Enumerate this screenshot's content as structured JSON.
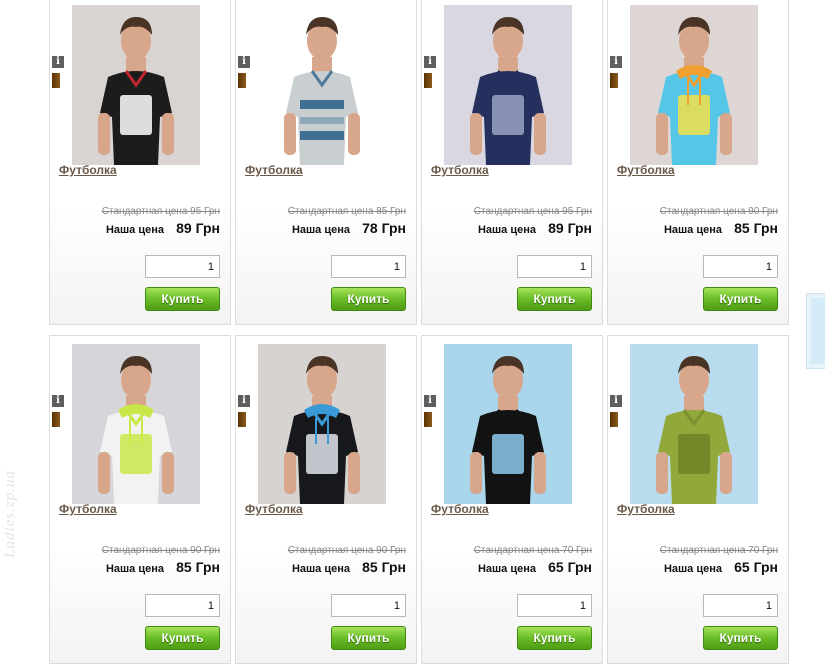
{
  "watermark": "Ladies.zp.ua",
  "buy_label": "Купить",
  "products": [
    {
      "name": "Футболка",
      "standard_price": "Стандартная цена 95 Грн",
      "our_label": "Наша цена",
      "our_price": "89 Грн",
      "qty": "1",
      "bg": "#d9d4d2",
      "shirt": "#1c1c1c",
      "trim": "#c0272d",
      "print": "#ffffff",
      "sleeve": "short",
      "hood": false
    },
    {
      "name": "Футболка",
      "standard_price": "Стандартная цена 85 Грн",
      "our_label": "Наша цена",
      "our_price": "78 Грн",
      "qty": "1",
      "bg": "#ffffff",
      "shirt": "#c9ced0",
      "trim": "#4d7a9a",
      "print": "stripes",
      "sleeve": "short",
      "hood": false
    },
    {
      "name": "Футболка",
      "standard_price": "Стандартная цена 95 Грн",
      "our_label": "Наша цена",
      "our_price": "89 Грн",
      "qty": "1",
      "bg": "#d9d7e1",
      "shirt": "#26305e",
      "trim": "#26305e",
      "print": "#9aa4c2",
      "sleeve": "short",
      "hood": false
    },
    {
      "name": "Футболка",
      "standard_price": "Стандартная цена 90 Грн",
      "our_label": "Наша цена",
      "our_price": "85 Грн",
      "qty": "1",
      "bg": "#ddd6d4",
      "shirt": "#56c6e8",
      "trim": "#f0a030",
      "print": "#f2e04a",
      "sleeve": "short",
      "hood": true
    },
    {
      "name": "Футболка",
      "standard_price": "Стандартная цена 90 Грн",
      "our_label": "Наша цена",
      "our_price": "85 Грн",
      "qty": "1",
      "bg": "#d6d6da",
      "shirt": "#f2f2f2",
      "trim": "#c8e84a",
      "print": "#c8e84a",
      "sleeve": "short",
      "hood": true
    },
    {
      "name": "Футболка",
      "standard_price": "Стандартная цена 90 Грн",
      "our_label": "Наша цена",
      "our_price": "85 Грн",
      "qty": "1",
      "bg": "#d7d3d0",
      "shirt": "#16181c",
      "trim": "#3a9ad8",
      "print": "#dfe4ea",
      "sleeve": "short",
      "hood": true
    },
    {
      "name": "Футболка",
      "standard_price": "Стандартная цена 70 Грн",
      "our_label": "Наша цена",
      "our_price": "65 Грн",
      "qty": "1",
      "bg": "#a9d6ea",
      "shirt": "#121212",
      "trim": "#121212",
      "print": "#8ec9ee",
      "sleeve": "short",
      "hood": false
    },
    {
      "name": "Футболка",
      "standard_price": "Стандартная цена 70 Грн",
      "our_label": "Наша цена",
      "our_price": "65 Грн",
      "qty": "1",
      "bg": "#b8dcee",
      "shirt": "#93a83a",
      "trim": "#7e9130",
      "print": "#6e8228",
      "sleeve": "short",
      "hood": false
    }
  ]
}
